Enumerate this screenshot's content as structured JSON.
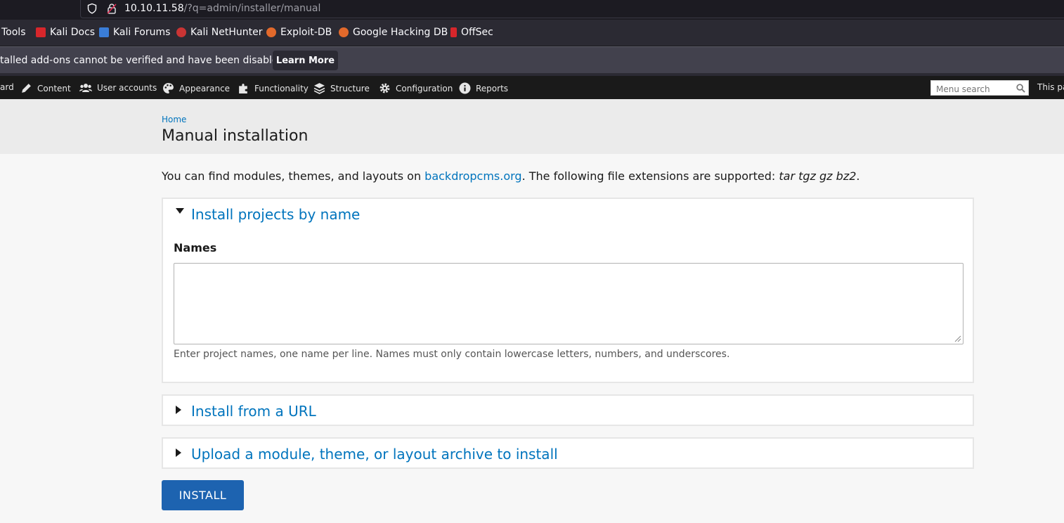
{
  "browser": {
    "url_host": "10.10.11.58",
    "url_path": "/?q=admin/installer/manual"
  },
  "bookmarks": [
    {
      "label": "Tools",
      "icon": "none"
    },
    {
      "label": "Kali Docs",
      "icon": "kali-docs-icon"
    },
    {
      "label": "Kali Forums",
      "icon": "kali-forums-icon"
    },
    {
      "label": "Kali NetHunter",
      "icon": "kali-nethunter-icon"
    },
    {
      "label": "Exploit-DB",
      "icon": "exploit-db-icon"
    },
    {
      "label": "Google Hacking DB",
      "icon": "ghdb-icon"
    },
    {
      "label": "OffSec",
      "icon": "offsec-icon"
    }
  ],
  "notification": {
    "text": "talled add-ons cannot be verified and have been disabled.",
    "button": "Learn More"
  },
  "admin_menu": {
    "items": [
      {
        "label": "ard",
        "icon": "none"
      },
      {
        "label": "Content",
        "icon": "pencil-icon"
      },
      {
        "label": "User accounts",
        "icon": "users-icon"
      },
      {
        "label": "Appearance",
        "icon": "palette-icon"
      },
      {
        "label": "Functionality",
        "icon": "puzzle-icon"
      },
      {
        "label": "Structure",
        "icon": "layers-icon"
      },
      {
        "label": "Configuration",
        "icon": "gear-icon"
      },
      {
        "label": "Reports",
        "icon": "info-icon"
      }
    ],
    "search_placeholder": "Menu search",
    "right_text": "This pa"
  },
  "page": {
    "breadcrumb": "Home",
    "title": "Manual installation",
    "intro_before": "You can find modules, themes, and layouts on ",
    "intro_link": "backdropcms.org",
    "intro_after": ". The following file extensions are supported: ",
    "intro_extensions": "tar tgz gz bz2",
    "intro_end": ".",
    "sections": [
      {
        "legend": "Install projects by name",
        "expanded": true
      },
      {
        "legend": "Install from a URL",
        "expanded": false
      },
      {
        "legend": "Upload a module, theme, or layout archive to install",
        "expanded": false
      }
    ],
    "names_label": "Names",
    "names_value": "",
    "names_help": "Enter project names, one name per line. Names must only contain lowercase letters, numbers, and underscores.",
    "install_button": "INSTALL"
  },
  "colors": {
    "link": "#0074bd",
    "primary_button": "#1d63b0",
    "admin_bar": "#1a1a1a"
  }
}
